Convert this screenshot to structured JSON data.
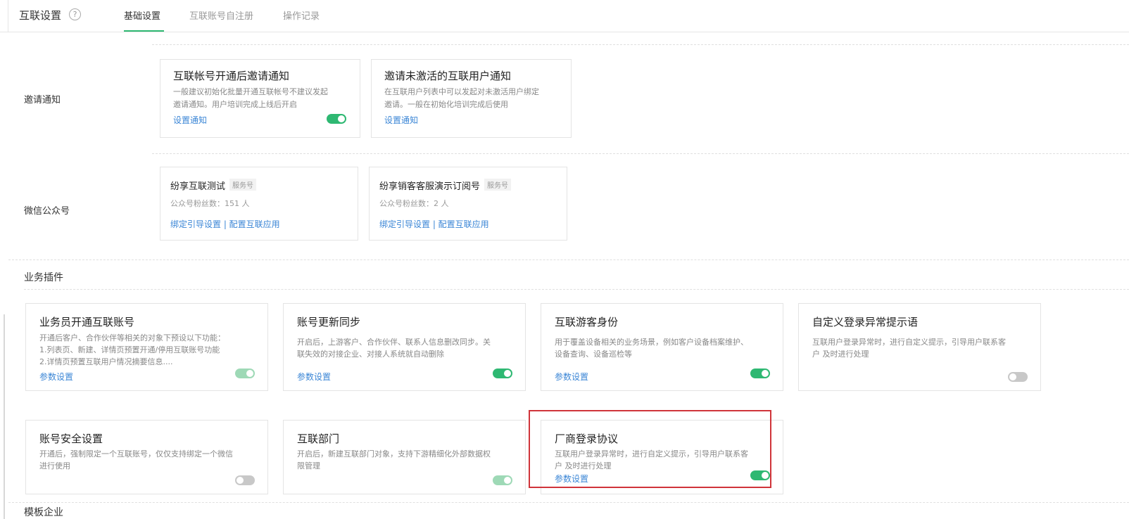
{
  "header": {
    "title": "互联设置",
    "help_icon": "?",
    "tabs": [
      {
        "label": "基础设置",
        "active": true
      },
      {
        "label": "互联账号自注册",
        "active": false
      },
      {
        "label": "操作记录",
        "active": false
      }
    ]
  },
  "invite": {
    "label": "邀请通知",
    "cards": [
      {
        "title": "互联帐号开通后邀请通知",
        "desc1": "一般建议初始化批量开通互联帐号不建议发起",
        "desc2": "邀请通知。用户培训完成上线后开启",
        "link": "设置通知",
        "toggle": "on"
      },
      {
        "title": "邀请未激活的互联用户通知",
        "desc1": "在互联用户列表中可以发起对未激活用户绑定",
        "desc2": "邀请。一般在初始化培训完成后使用",
        "link": "设置通知"
      }
    ]
  },
  "wechat": {
    "label": "微信公众号",
    "cards": [
      {
        "name": "纷享互联测试",
        "badge": "服务号",
        "fans": "公众号粉丝数：151 人",
        "links": "绑定引导设置 | 配置互联应用"
      },
      {
        "name": "纷享销客客服演示订阅号",
        "badge": "服务号",
        "fans": "公众号粉丝数：2 人",
        "links": "绑定引导设置 | 配置互联应用"
      }
    ]
  },
  "plugins": {
    "title": "业务插件",
    "cards": [
      {
        "title": "业务员开通互联账号",
        "desc": [
          "开通后客户、合作伙伴等相关的对象下预设以下功能：",
          "1.列表页、新建、详情页预置开通/停用互联账号功能",
          "2.详情页预置互联用户情况摘要信息...."
        ],
        "link": "参数设置",
        "toggle": "faded"
      },
      {
        "title": "账号更新同步",
        "desc": [
          "开启后，上游客户、合作伙伴、联系人信息删改同步。关",
          "联失效的对接企业、对接人系统就自动删除"
        ],
        "link": "参数设置",
        "toggle": "on"
      },
      {
        "title": "互联游客身份",
        "desc": [
          "用于覆盖设备相关的业务场景，例如客户设备档案维护、",
          "设备查询、设备巡检等"
        ],
        "link": "参数设置",
        "toggle": "on"
      },
      {
        "title": "自定义登录异常提示语",
        "desc": [
          "互联用户登录异常时，进行自定义提示，引导用户联系客",
          "户 及时进行处理"
        ],
        "link": "",
        "toggle": "off"
      },
      {
        "title": "账号安全设置",
        "desc": [
          "开通后，强制限定一个互联账号，仅仅支持绑定一个微信",
          "进行使用"
        ],
        "link": "",
        "toggle": "off"
      },
      {
        "title": "互联部门",
        "desc": [
          "开启后，新建互联部门对象，支持下游精细化外部数据权",
          "限管理"
        ],
        "link": "",
        "toggle": "faded"
      },
      {
        "title": "厂商登录协议",
        "desc": [
          "互联用户登录异常时，进行自定义提示，引导用户联系客",
          "户 及时进行处理"
        ],
        "link": "参数设置",
        "toggle": "on"
      }
    ]
  },
  "bottom_section": {
    "title": "模板企业"
  },
  "colors": {
    "accent": "#2eb872",
    "link": "#3b86d6",
    "highlight": "#d0343a"
  }
}
